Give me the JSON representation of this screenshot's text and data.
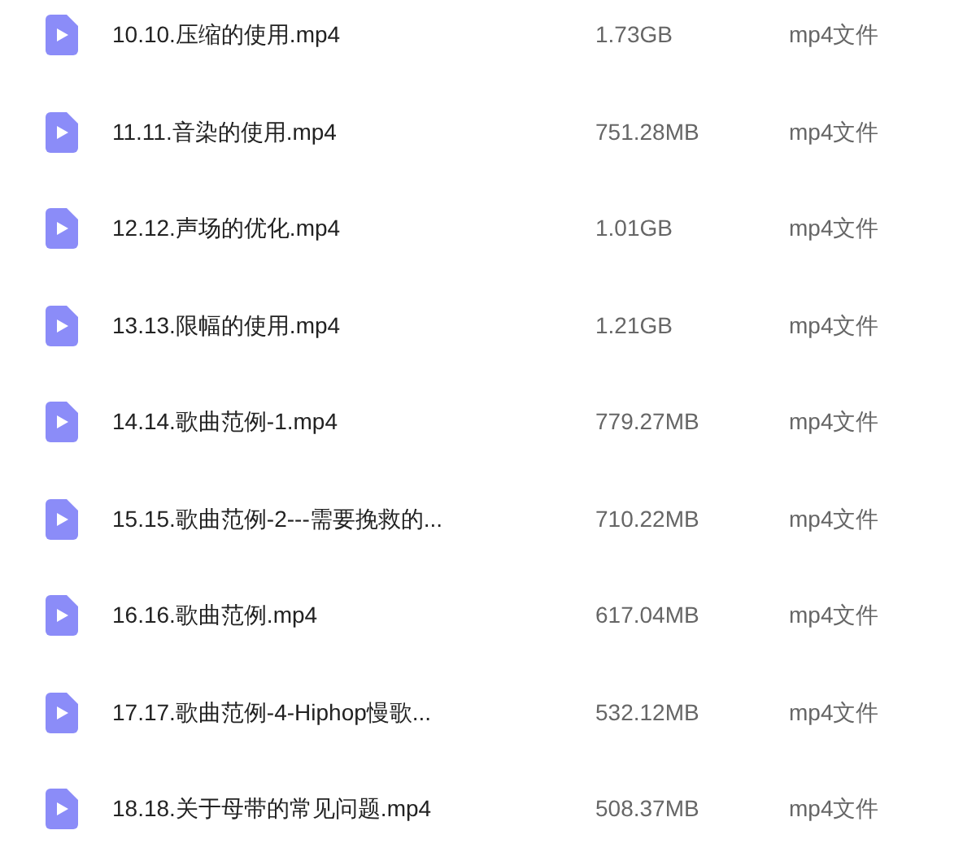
{
  "files": [
    {
      "name": "10.10.压缩的使用.mp4",
      "size": "1.73GB",
      "type": "mp4文件"
    },
    {
      "name": "11.11.音染的使用.mp4",
      "size": "751.28MB",
      "type": "mp4文件"
    },
    {
      "name": "12.12.声场的优化.mp4",
      "size": "1.01GB",
      "type": "mp4文件"
    },
    {
      "name": "13.13.限幅的使用.mp4",
      "size": "1.21GB",
      "type": "mp4文件"
    },
    {
      "name": "14.14.歌曲范例-1.mp4",
      "size": "779.27MB",
      "type": "mp4文件"
    },
    {
      "name": "15.15.歌曲范例-2---需要挽救的...",
      "size": "710.22MB",
      "type": "mp4文件"
    },
    {
      "name": "16.16.歌曲范例.mp4",
      "size": "617.04MB",
      "type": "mp4文件"
    },
    {
      "name": "17.17.歌曲范例-4-Hiphop慢歌...",
      "size": "532.12MB",
      "type": "mp4文件"
    },
    {
      "name": "18.18.关于母带的常见问题.mp4",
      "size": "508.37MB",
      "type": "mp4文件"
    }
  ]
}
